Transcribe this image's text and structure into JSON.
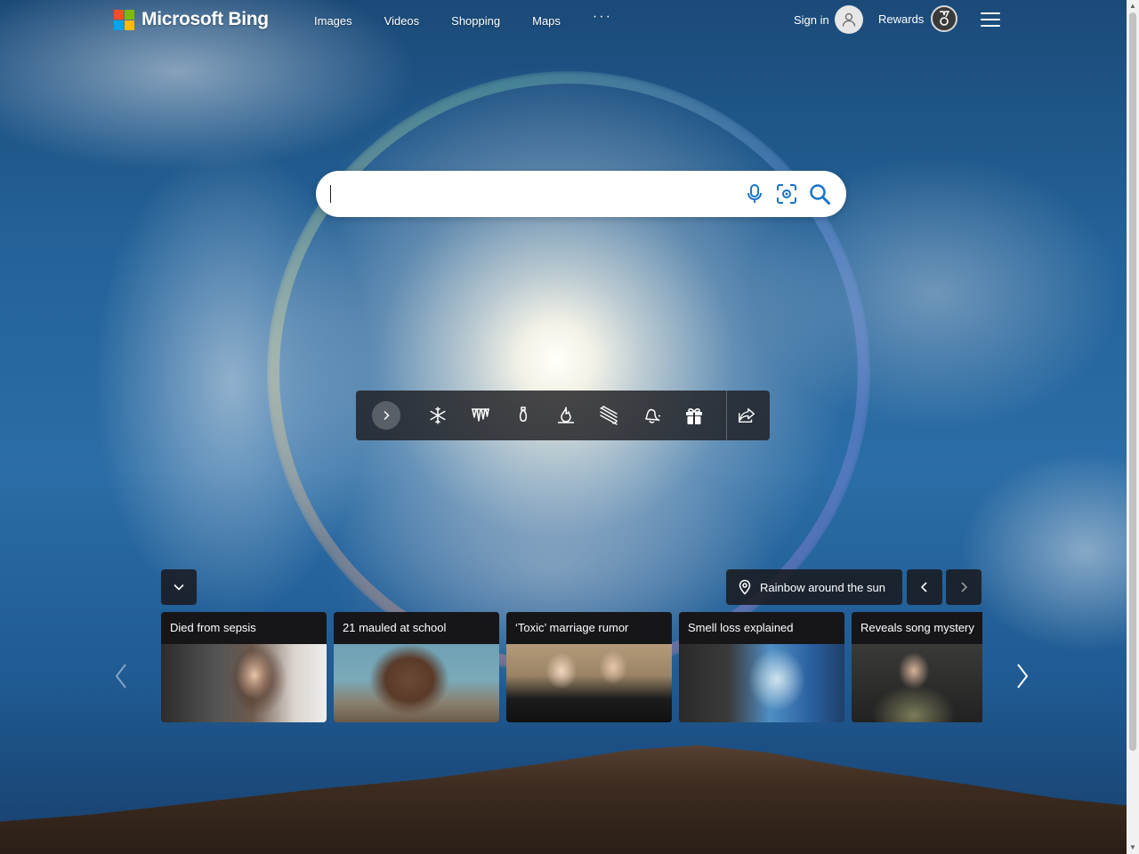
{
  "header": {
    "logo_text": "Microsoft Bing",
    "nav": [
      "Images",
      "Videos",
      "Shopping",
      "Maps"
    ],
    "more_label": "···",
    "signin_label": "Sign in",
    "rewards_label": "Rewards"
  },
  "search": {
    "value": "",
    "placeholder": ""
  },
  "toolbar": {
    "icons": [
      "snowflake-icon",
      "icicles-icon",
      "lightbulb-icon",
      "fire-icon",
      "ribbon-icon",
      "bell-icon",
      "gift-icon"
    ],
    "share_icon": "share-icon"
  },
  "image_info": {
    "label": "Rainbow around the sun"
  },
  "news_cards": [
    {
      "title": "Died from sepsis"
    },
    {
      "title": "21 mauled at school"
    },
    {
      "title": "‘Toxic’ marriage rumor"
    },
    {
      "title": "Smell loss explained"
    },
    {
      "title": "Reveals song mystery"
    }
  ],
  "colors": {
    "ms_red": "#f25022",
    "ms_green": "#7fba00",
    "ms_blue": "#00a4ef",
    "ms_yellow": "#ffb900",
    "search_icon_blue": "#1a73c8"
  }
}
